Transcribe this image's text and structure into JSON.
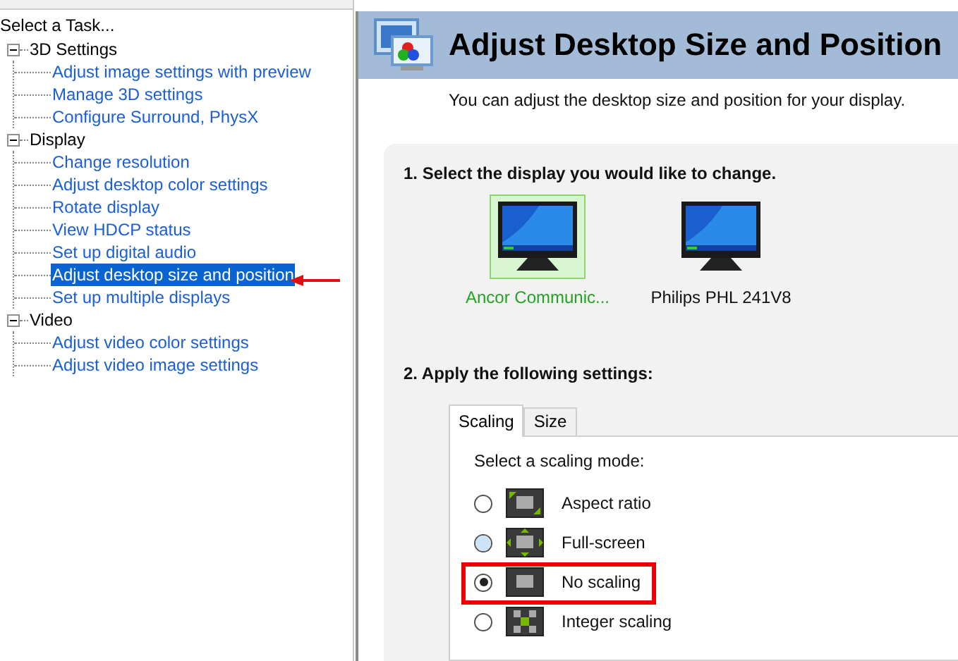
{
  "task_panel": {
    "title": "Select a Task...",
    "tree": [
      {
        "label": "3D Settings",
        "expanded": true,
        "children": [
          {
            "label": "Adjust image settings with preview",
            "selected": false
          },
          {
            "label": "Manage 3D settings",
            "selected": false
          },
          {
            "label": "Configure Surround, PhysX",
            "selected": false
          }
        ]
      },
      {
        "label": "Display",
        "expanded": true,
        "children": [
          {
            "label": "Change resolution",
            "selected": false
          },
          {
            "label": "Adjust desktop color settings",
            "selected": false
          },
          {
            "label": "Rotate display",
            "selected": false
          },
          {
            "label": "View HDCP status",
            "selected": false
          },
          {
            "label": "Set up digital audio",
            "selected": false
          },
          {
            "label": "Adjust desktop size and position",
            "selected": true
          },
          {
            "label": "Set up multiple displays",
            "selected": false
          }
        ]
      },
      {
        "label": "Video",
        "expanded": true,
        "children": [
          {
            "label": "Adjust video color settings",
            "selected": false
          },
          {
            "label": "Adjust video image settings",
            "selected": false
          }
        ]
      }
    ]
  },
  "page": {
    "title": "Adjust Desktop Size and Position",
    "description": "You can adjust the desktop size and position for your display.",
    "step_1": "1. Select the display you would like to change.",
    "displays": [
      {
        "label": "Ancor Communic...",
        "selected": true
      },
      {
        "label": "Philips PHL 241V8",
        "selected": false
      }
    ],
    "step_2": "2. Apply the following settings:",
    "tabs": [
      {
        "label": "Scaling",
        "selected": true
      },
      {
        "label": "Size",
        "selected": false
      }
    ],
    "scaling_prompt": "Select a scaling mode:",
    "scaling_modes": [
      {
        "label": "Aspect ratio",
        "kind": "aspect",
        "selected": false,
        "hovered": false
      },
      {
        "label": "Full-screen",
        "kind": "full",
        "selected": false,
        "hovered": true
      },
      {
        "label": "No scaling",
        "kind": "none",
        "selected": true,
        "hovered": false
      },
      {
        "label": "Integer scaling",
        "kind": "integer",
        "selected": false,
        "hovered": false
      }
    ]
  }
}
